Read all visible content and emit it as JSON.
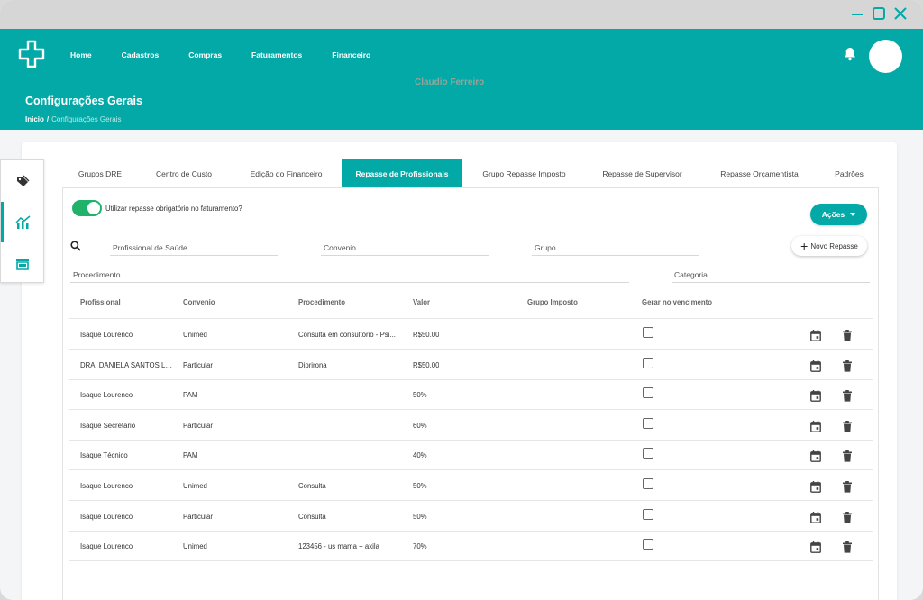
{
  "header": {
    "nav": [
      "Home",
      "Cadastros",
      "Compras",
      "Faturamentos",
      "Financeiro"
    ],
    "user_name": "Claudio Ferreiro",
    "page_title": "Configurações Gerais",
    "breadcrumb": {
      "home": "Inicio",
      "separator": "/",
      "current": "Configurações Gerais"
    }
  },
  "sidebar": {
    "icons": [
      "tags-icon",
      "chart-icon",
      "store-icon"
    ],
    "active_index": 1
  },
  "tabs": [
    "Grupos DRE",
    "Centro de Custo",
    "Edição do Financeiro",
    "Repasse de Profissionais",
    "Grupo Repasse Imposto",
    "Repasse de Supervisor",
    "Repasse Orçamentista",
    "Padrões"
  ],
  "active_tab": 3,
  "toggle": {
    "label": "Utilizar repasse obrigatório no faturamento?",
    "on": true
  },
  "actions_button": "Ações",
  "filters": {
    "profissional": "Profissional de Saúde",
    "convenio": "Convenio",
    "grupo": "Grupo",
    "procedimento": "Procedimento",
    "categoria": "Categoria"
  },
  "new_button": "Novo Repasse",
  "table": {
    "columns": [
      "Profissional",
      "Convenio",
      "Procedimento",
      "Valor",
      "Grupo Imposto",
      "Gerar no vencimento"
    ],
    "rows": [
      [
        "Isaque Lourenco",
        "Unimed",
        "Consulta em consultório - Psi...",
        "R$50.00",
        "",
        ""
      ],
      [
        "DRA. DANIELA SANTOS LIS...",
        "Particular",
        "Diprirona",
        "R$50.00",
        "",
        ""
      ],
      [
        "Isaque Lourenco",
        "PAM",
        "",
        "50%",
        "",
        ""
      ],
      [
        "Isaque Secretario",
        "Particular",
        "",
        "60%",
        "",
        ""
      ],
      [
        "Isaque Técnico",
        "PAM",
        "",
        "40%",
        "",
        ""
      ],
      [
        "Isaque Lourenco",
        "Unimed",
        "Consulta",
        "50%",
        "",
        ""
      ],
      [
        "Isaque Lourenco",
        "Particular",
        "Consulta",
        "50%",
        "",
        ""
      ],
      [
        "Isaque Lourenco",
        "Unimed",
        "123456 - us mama + axila",
        "70%",
        "",
        ""
      ]
    ]
  },
  "colors": {
    "primary": "#03a9a7",
    "toggle_on": "#20b26a"
  }
}
